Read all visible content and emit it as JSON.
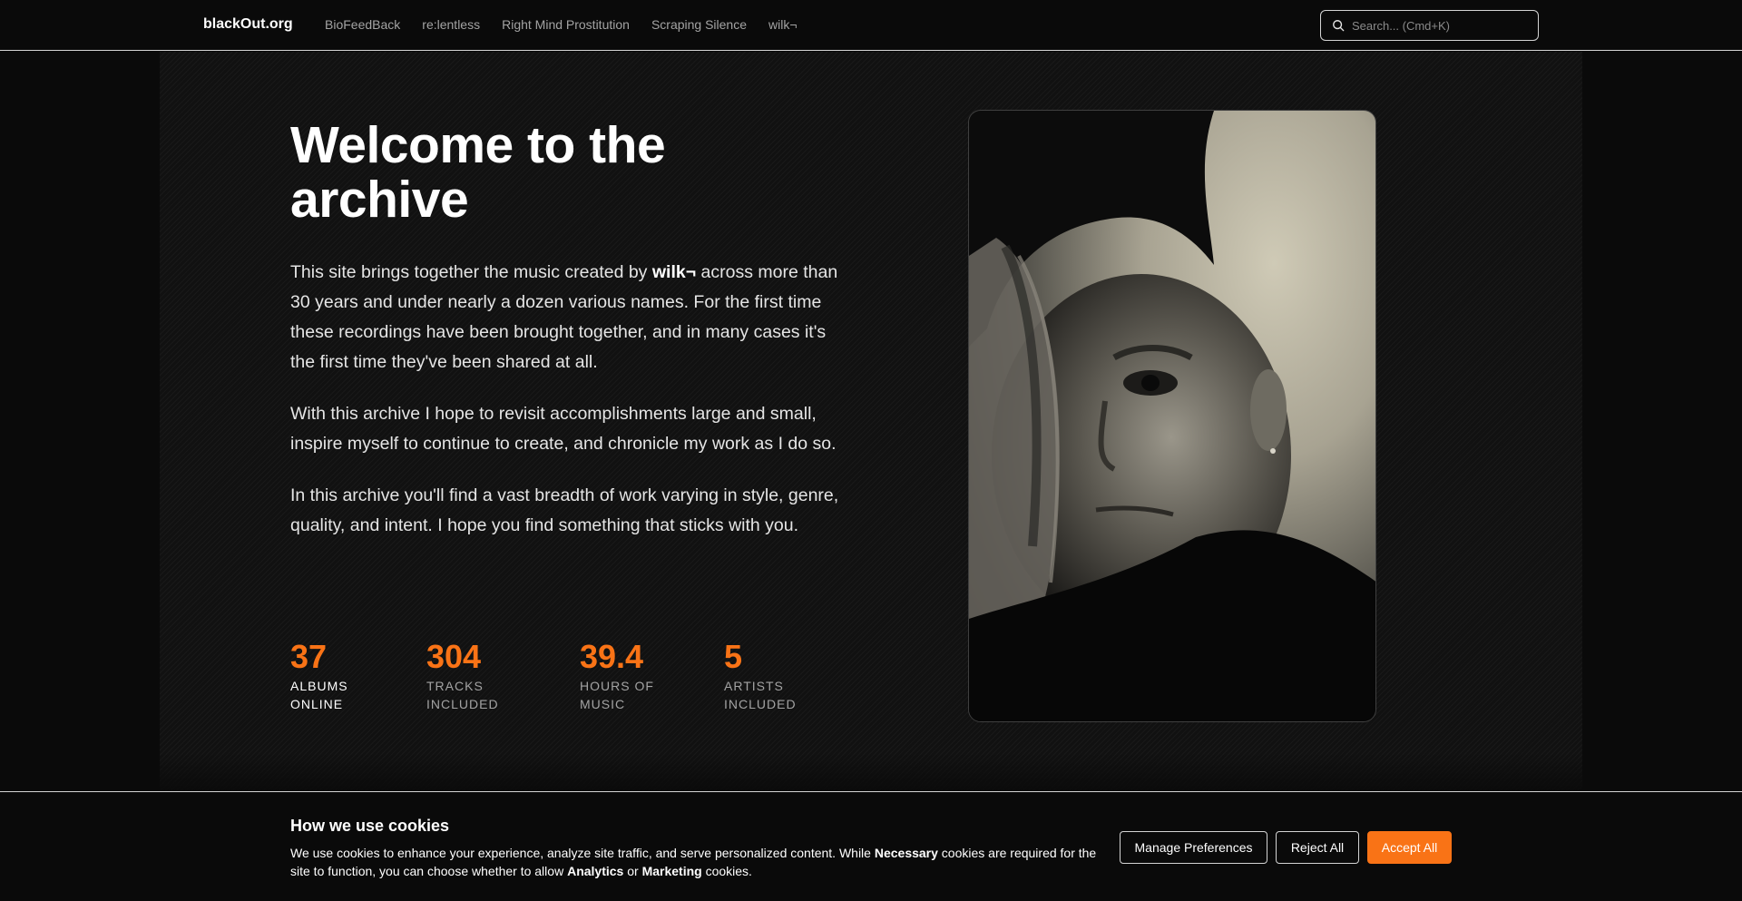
{
  "nav": {
    "brand": "blackOut.org",
    "links": [
      "BioFeedBack",
      "re:lentless",
      "Right Mind Prostitution",
      "Scraping Silence",
      "wilk¬"
    ],
    "search_placeholder": "Search... (Cmd+K)",
    "search_icon": "search-icon"
  },
  "hero": {
    "title": "Welcome to the archive",
    "p1_before": "This site brings together the music created by ",
    "p1_bold": "wilk¬",
    "p1_after": " across more than 30 years and under nearly a dozen various names. For the first time these recordings have been brought together, and in many cases it's the first time they've been shared at all.",
    "p2": "With this archive I hope to revisit accomplishments large and small, inspire myself to continue to create, and chronicle my work as I do so.",
    "p3": "In this archive you'll find a vast breadth of work varying in style, genre, quality, and intent. I hope you find something that sticks with you.",
    "stats": [
      {
        "value": "37",
        "label": "ALBUMS ONLINE"
      },
      {
        "value": "304",
        "label": "TRACKS INCLUDED"
      },
      {
        "value": "39.4",
        "label": "HOURS OF MUSIC"
      },
      {
        "value": "5",
        "label": "ARTISTS INCLUDED"
      }
    ],
    "accent_color": "#f97316"
  },
  "cookie": {
    "title": "How we use cookies",
    "text_1": "We use cookies to enhance your experience, analyze site traffic, and serve personalized content. While ",
    "bold_1": "Necessary",
    "text_2": " cookies are required for the site to function, you can choose whether to allow ",
    "bold_2": "Analytics",
    "text_3": " or ",
    "bold_3": "Marketing",
    "text_4": " cookies.",
    "manage_label": "Manage Preferences",
    "reject_label": "Reject All",
    "accept_label": "Accept All"
  }
}
